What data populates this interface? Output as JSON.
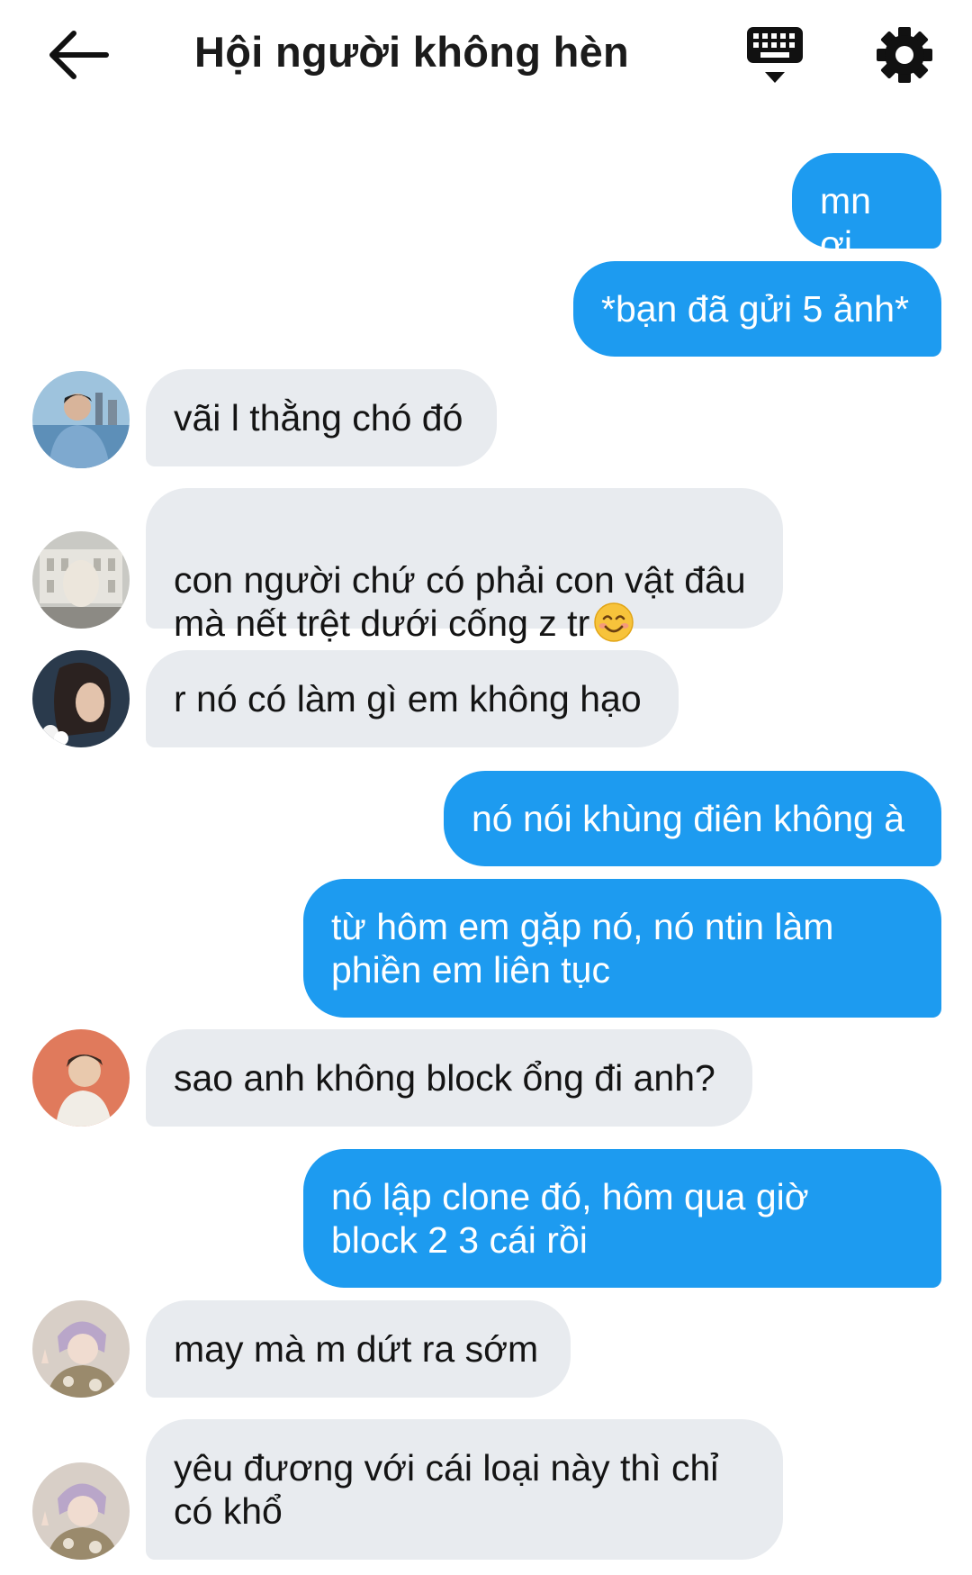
{
  "header": {
    "title": "Hội người không hèn",
    "back_icon": "arrow-left-icon",
    "keyboard_icon": "keyboard-icon",
    "settings_icon": "gear-icon"
  },
  "colors": {
    "outgoing_bubble": "#1d9bf0",
    "incoming_bubble": "#e8ebef",
    "outgoing_text": "#ffffff",
    "incoming_text": "#141414"
  },
  "messages": [
    {
      "direction": "outgoing",
      "text": "mn ơi"
    },
    {
      "direction": "outgoing",
      "text": "*bạn đã gửi 5 ảnh*"
    },
    {
      "direction": "incoming",
      "avatar": "avatar-1",
      "text": "vãi l thằng chó đó"
    },
    {
      "direction": "incoming",
      "avatar": "avatar-2",
      "text": "con người chứ có phải con vật đâu\nmà nết trệt dưới cống z tr",
      "emoji": "smiling-face-emoji"
    },
    {
      "direction": "incoming",
      "avatar": "avatar-3",
      "text": "r nó có làm gì em không hạo"
    },
    {
      "direction": "outgoing",
      "text": "nó nói khùng điên không à"
    },
    {
      "direction": "outgoing",
      "text": "từ hôm em gặp nó, nó ntin làm\nphiền em liên tục"
    },
    {
      "direction": "incoming",
      "avatar": "avatar-4",
      "text": "sao anh không block ổng đi anh?"
    },
    {
      "direction": "outgoing",
      "text": "nó lập clone đó, hôm qua giờ\nblock 2 3 cái rồi"
    },
    {
      "direction": "incoming",
      "avatar": "avatar-5",
      "text": "may mà m dứt ra sớm"
    },
    {
      "direction": "incoming",
      "avatar": "avatar-5",
      "text": "yêu đương với cái loại này thì chỉ\ncó khổ"
    }
  ]
}
